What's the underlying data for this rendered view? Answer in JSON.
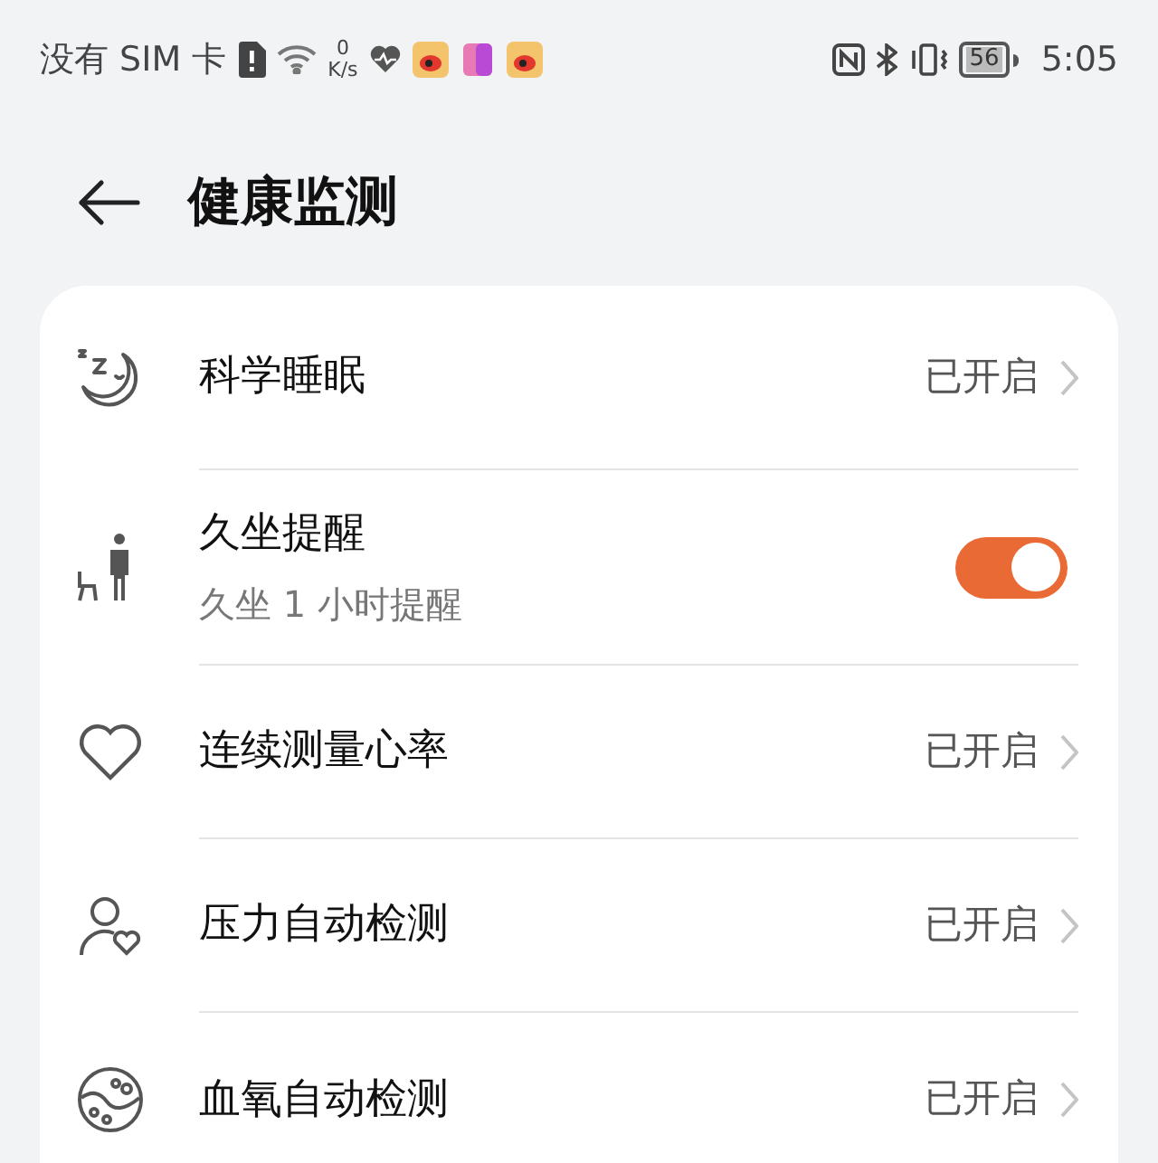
{
  "status_bar": {
    "carrier": "没有 SIM 卡",
    "speed_value": "0",
    "speed_unit": "K/s",
    "battery": "56",
    "time": "5:05"
  },
  "header": {
    "title": "健康监测"
  },
  "items": [
    {
      "kind": "link",
      "title": "科学睡眠",
      "value": "已开启"
    },
    {
      "kind": "toggle",
      "title": "久坐提醒",
      "subtitle": "久坐 1 小时提醒",
      "on": true
    },
    {
      "kind": "link",
      "title": "连续测量心率",
      "value": "已开启"
    },
    {
      "kind": "link",
      "title": "压力自动检测",
      "value": "已开启"
    },
    {
      "kind": "link",
      "title": "血氧自动检测",
      "value": "已开启"
    }
  ]
}
